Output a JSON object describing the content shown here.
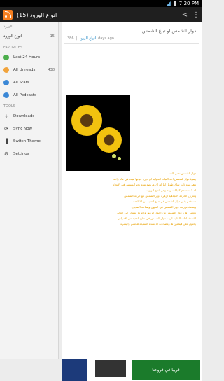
{
  "status": {
    "time": "7:20 PM"
  },
  "app": {
    "title": "انواع الورود (15)"
  },
  "drawer": {
    "favorites_header": "FAVORITES",
    "feeds_header": "الورود",
    "feed_name": "انواع الورود",
    "feed_count": "15",
    "items": [
      {
        "label": "Last 24 Hours"
      },
      {
        "label": "All Unreads",
        "count": "438"
      },
      {
        "label": "All Stars"
      },
      {
        "label": "All Podcasts"
      }
    ],
    "tools_header": "TOOLS",
    "tools": [
      {
        "label": "Downloads"
      },
      {
        "label": "Sync Now"
      },
      {
        "label": "Switch Theme"
      },
      {
        "label": "Settings"
      }
    ]
  },
  "article": {
    "title": "دوار الشمس او تباع الشمس",
    "count": "386",
    "time": "days ago",
    "source": "انواع الورود"
  },
  "body": [
    "دوار الشمس تعني النبته",
    "زهرة دوار الشمس احد النبات الحولية اي دورة حياتها تنبت في عام واحد",
    "وهي نبتة ذات ساق طويل لها اوراق عريضة تتجه نحو الشمس في الاتجاه",
    "اصلا تستخدم كنباتات زينه وفي انتاج الزيوت",
    "وتعرف الحركة الاتجاهية لزهرة دوار الشمس مع حركة الشمس",
    "تستخدم بذور دوار الشمس في صنع العديد من الاطعمة",
    "ويستخدم زيت دوار الشمس في الطهي وصناعة الصابون",
    "وتعتبر زهرة دوار الشمس من اجمل الزهور واكثرها انتشارا في العالم",
    "الاستخدامات الطبية لزيت دوار الشمس في علاج العديد من الامراض",
    "يحتوي على فيتامين هـ ومضادات الاكسدة المفيدة للجسم والبشرة"
  ],
  "ad": {
    "text": "قريبا في فروعنا"
  }
}
